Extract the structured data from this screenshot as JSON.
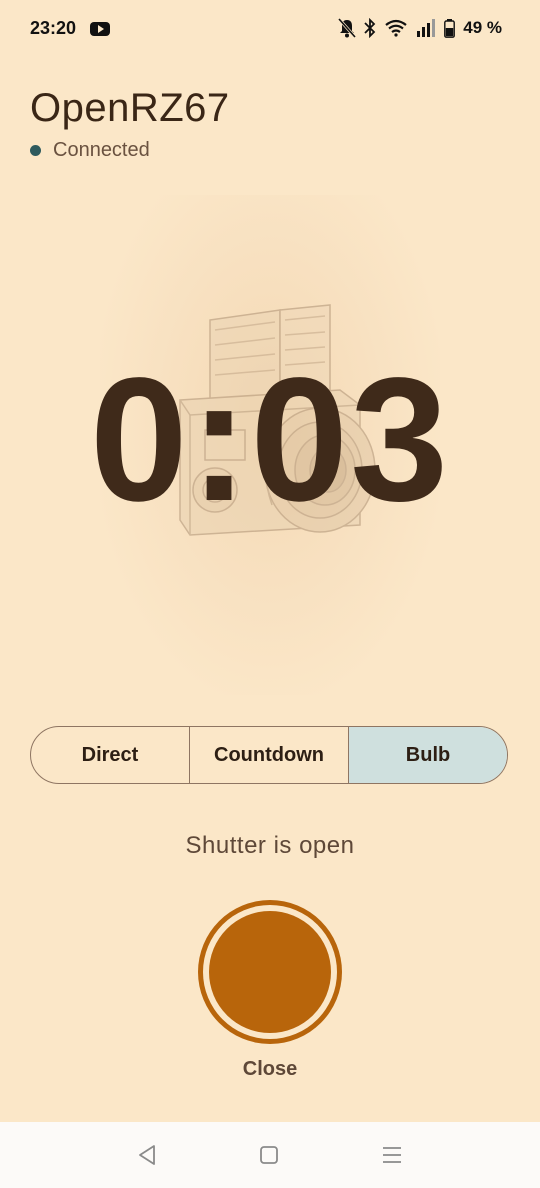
{
  "status_bar": {
    "time": "23:20",
    "battery": "49 %",
    "icons": [
      "youtube-icon",
      "bell-off-icon",
      "bluetooth-icon",
      "wifi-icon",
      "signal-icon",
      "battery-icon"
    ]
  },
  "header": {
    "title": "OpenRZ67",
    "connection_status": "Connected",
    "connection_color": "#2e5a5d"
  },
  "timer": {
    "value": "0:03"
  },
  "modes": {
    "items": [
      {
        "label": "Direct",
        "active": false
      },
      {
        "label": "Countdown",
        "active": false
      },
      {
        "label": "Bulb",
        "active": true
      }
    ]
  },
  "shutter": {
    "status": "Shutter is open",
    "button_label": "Close",
    "color": "#b8650b"
  },
  "nav": {
    "icons": [
      "back-icon",
      "home-icon",
      "recents-icon"
    ]
  },
  "colors": {
    "background": "#fbe7c8",
    "text": "#3f2a1a",
    "active_mode": "#cfe0de"
  }
}
